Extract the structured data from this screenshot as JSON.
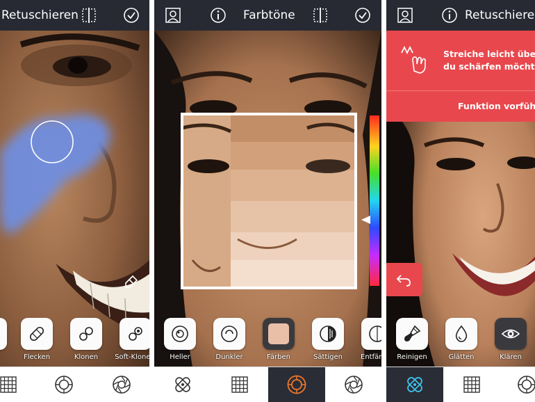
{
  "panel_left": {
    "title": "Retuschieren",
    "tools": [
      {
        "label": "Flecken",
        "icon": "bandage-icon"
      },
      {
        "label": "Klonen",
        "icon": "clone-icon"
      },
      {
        "label": "Soft-Klonen",
        "icon": "soft-clone-icon"
      }
    ],
    "nav": [
      "grid-icon",
      "lens-icon",
      "aperture-icon"
    ]
  },
  "panel_middle": {
    "title": "Farbtöne",
    "tools": [
      {
        "label": "Heller",
        "icon": "lighten-icon"
      },
      {
        "label": "Dunkler",
        "icon": "darken-icon"
      },
      {
        "label": "Färben",
        "icon": "color-swatch-icon",
        "swatch_color": "#e9bfa8"
      },
      {
        "label": "Sättigen",
        "icon": "saturation-icon"
      },
      {
        "label": "Entfärben",
        "icon": "desaturate-icon"
      }
    ],
    "nav": [
      "bandage-icon",
      "grid-icon",
      "lens-icon",
      "aperture-icon"
    ],
    "active_nav": "lens-icon"
  },
  "panel_right": {
    "title": "Retuschieren",
    "hint_line1": "Streiche leicht über",
    "hint_line2": "du schärfen möchtest",
    "demo_label": "Funktion vorführen",
    "tools": [
      {
        "label": "Reinigen",
        "icon": "brush-icon"
      },
      {
        "label": "Glätten",
        "icon": "drop-icon"
      },
      {
        "label": "Klären",
        "icon": "eye-icon"
      }
    ],
    "nav": [
      "bandage-icon",
      "grid-icon",
      "lens-icon"
    ],
    "active_nav": "bandage-icon"
  },
  "colors": {
    "topbar": "#272a33",
    "accent_orange": "#f0772b",
    "accent_cyan": "#3fc3ee",
    "hint_red": "#e8484d",
    "brush_blue": "#6f8ee0"
  }
}
